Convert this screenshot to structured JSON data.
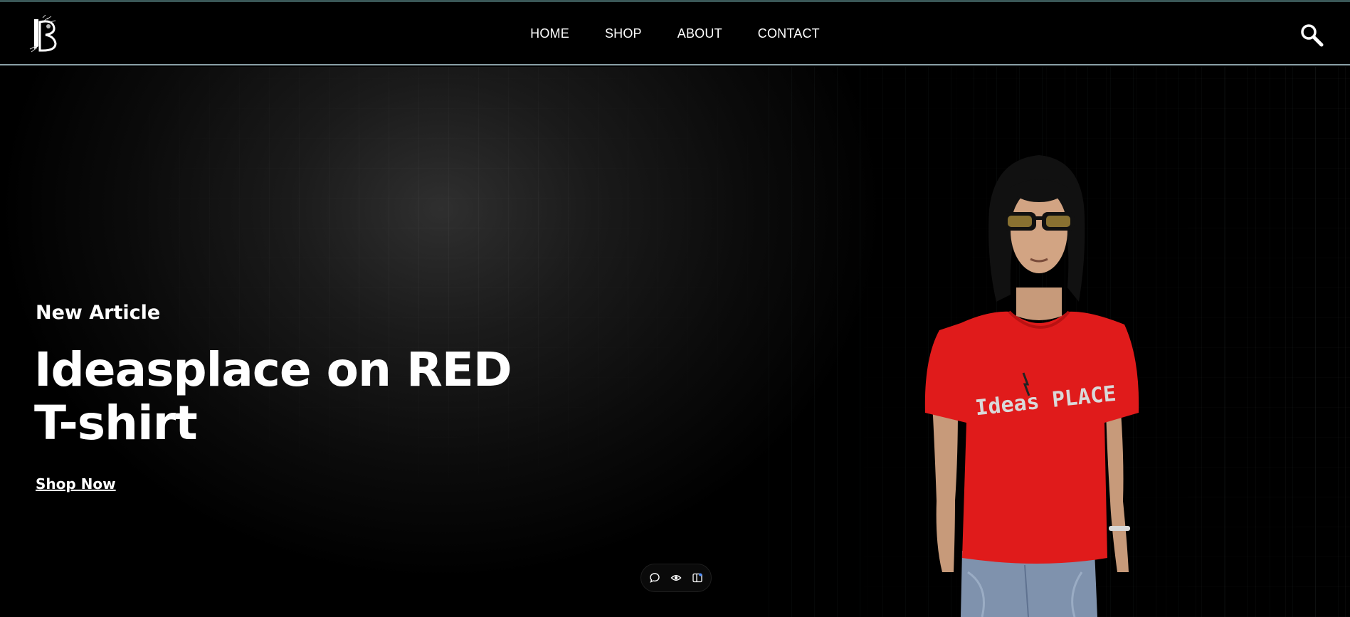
{
  "brand": {
    "logo_icon": "brand-logo-icon"
  },
  "nav": {
    "items": [
      {
        "label": "HOME"
      },
      {
        "label": "SHOP"
      },
      {
        "label": "ABOUT"
      },
      {
        "label": "CONTACT"
      }
    ]
  },
  "header": {
    "search_icon": "search-icon"
  },
  "hero": {
    "eyebrow": "New Article",
    "headline_line1": "Ideasplace on RED",
    "headline_line2": "T-shirt",
    "cta_label": "Shop Now",
    "image_subject": "model-wearing-red-t-shirt",
    "shirt_print": "Ideas PLACE",
    "accent_color": "#e01b1b"
  },
  "floating_toolbar": {
    "icons": [
      "comment-icon",
      "eye-icon",
      "panel-icon"
    ]
  },
  "colors": {
    "background": "#000000",
    "text": "#ffffff",
    "header_border": "#8aa0a6"
  }
}
